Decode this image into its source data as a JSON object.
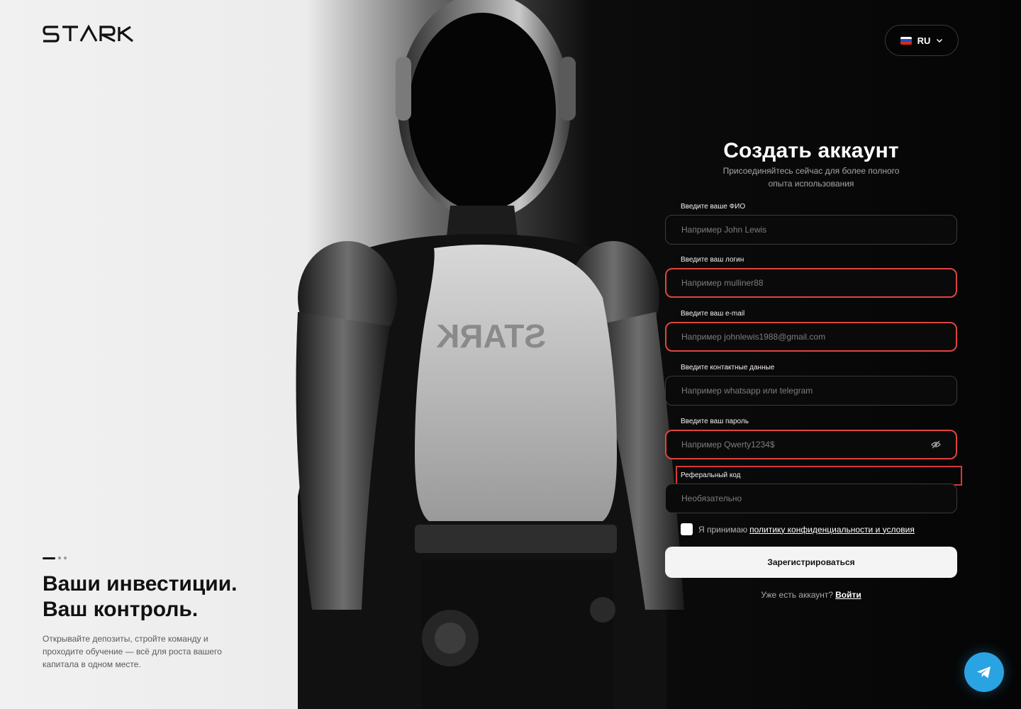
{
  "brand": {
    "name": "STARK"
  },
  "language": {
    "code": "RU",
    "flag_colors": [
      "#ffffff",
      "#1c4fc4",
      "#d52b1e"
    ]
  },
  "hero": {
    "title_line1": "Ваши инвестиции.",
    "title_line2": "Ваш контроль.",
    "description": "Открывайте депозиты, стройте команду и проходите обучение — всё для роста вашего капитала в одном месте.",
    "slides_total": 3,
    "slide_active": 1
  },
  "form": {
    "title": "Создать аккаунт",
    "subtitle": "Присоединяйтесь сейчас для более полного опыта использования",
    "fields": [
      {
        "label": "Введите ваше ФИО",
        "placeholder": "Например John Lewis",
        "error": false
      },
      {
        "label": "Введите ваш логин",
        "placeholder": "Например mulliner88",
        "error": true
      },
      {
        "label": "Введите ваш e-mail",
        "placeholder": "Например johnlewis1988@gmail.com",
        "error": true
      },
      {
        "label": "Введите контактные данные",
        "placeholder": "Например whatsapp или telegram",
        "error": false
      },
      {
        "label": "Введите ваш пароль",
        "placeholder": "Например Qwerty1234$",
        "error": true
      },
      {
        "label": "Реферальный код",
        "placeholder": "Необязательно",
        "error": false
      }
    ],
    "agree_text": "Я принимаю",
    "agree_link": "политику конфиденциальности и условия",
    "submit_label": "Зарегистрироваться",
    "login_question": "Уже есть аккаунт?",
    "login_link": "Войти"
  },
  "colors": {
    "error": "#e0443f",
    "telegram": "#2aa3e2"
  }
}
